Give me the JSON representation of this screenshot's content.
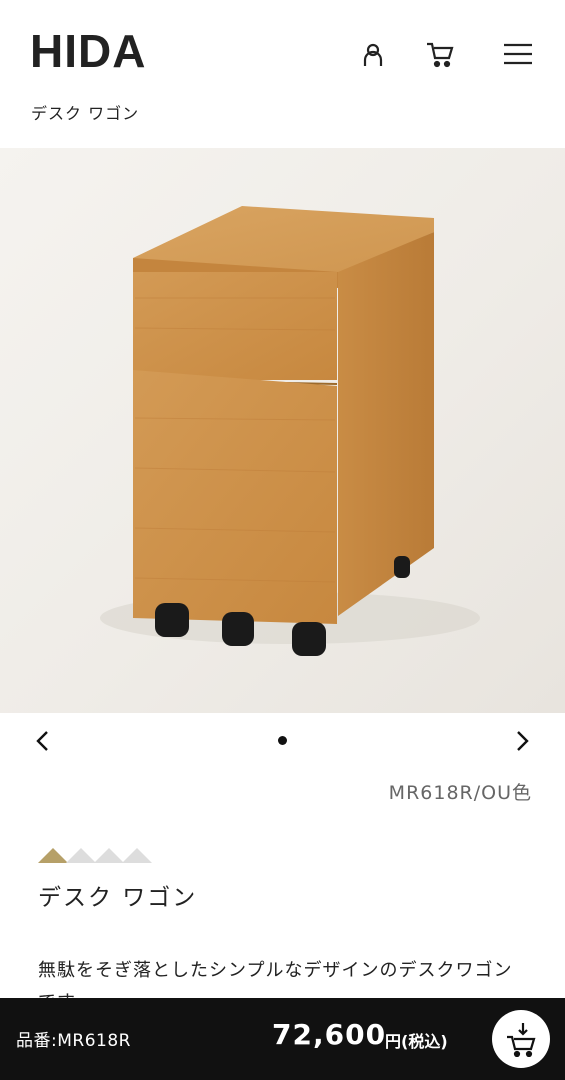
{
  "header": {
    "logo": "HIDA",
    "breadcrumb": "デスク ワゴン",
    "icons": [
      "user-icon",
      "cart-icon",
      "menu-icon"
    ]
  },
  "carousel": {
    "variant_label": "MR618R/OU色",
    "image_alt": "oak desk wagon on casters"
  },
  "product": {
    "rating": {
      "filled": 1,
      "total": 4,
      "color_on": "#b6a068",
      "color_off": "#dddddd"
    },
    "title": "デスク ワゴン",
    "description": "無駄をそぎ落としたシンプルなデザインのデスクワゴンです。"
  },
  "purchase_bar": {
    "code": "品番:MR618R",
    "price": "72,600",
    "tax_label": "円(税込)",
    "cart_icon": "add-to-cart-icon"
  },
  "colors": {
    "bar": "#111111",
    "accent": "#b6a068"
  }
}
